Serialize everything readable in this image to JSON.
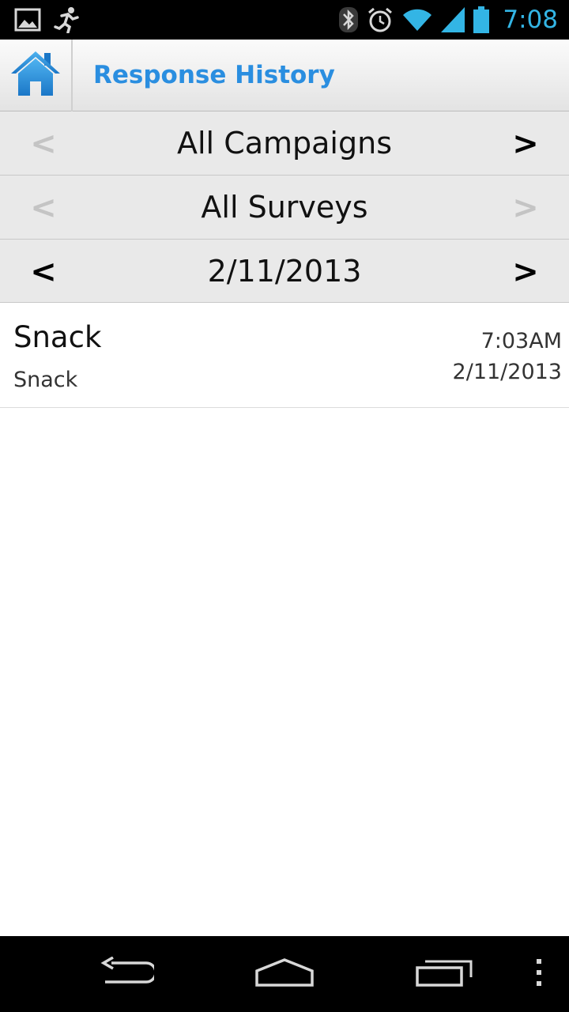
{
  "status_bar": {
    "time": "7:08",
    "left_icons": [
      "image-icon",
      "running-person-icon"
    ],
    "right_icons": [
      "bluetooth-icon",
      "alarm-icon",
      "wifi-icon",
      "signal-icon",
      "battery-icon"
    ],
    "accent_color": "#33b5e5"
  },
  "action_bar": {
    "title": "Response History",
    "home_icon": "home-icon",
    "title_color": "#2a8ee0"
  },
  "filters": {
    "campaign": {
      "label": "All Campaigns",
      "prev": "<",
      "next": ">",
      "prev_enabled": false,
      "next_enabled": true
    },
    "survey": {
      "label": "All Surveys",
      "prev": "<",
      "next": ">",
      "prev_enabled": false,
      "next_enabled": false
    },
    "date": {
      "label": "2/11/2013",
      "prev": "<",
      "next": ">",
      "prev_enabled": true,
      "next_enabled": true
    }
  },
  "responses": [
    {
      "title": "Snack",
      "subtitle": "Snack",
      "time": "7:03AM",
      "date": "2/11/2013"
    }
  ],
  "nav_bar": {
    "buttons": [
      "back-icon",
      "home-icon",
      "recent-apps-icon",
      "overflow-menu-icon"
    ]
  }
}
